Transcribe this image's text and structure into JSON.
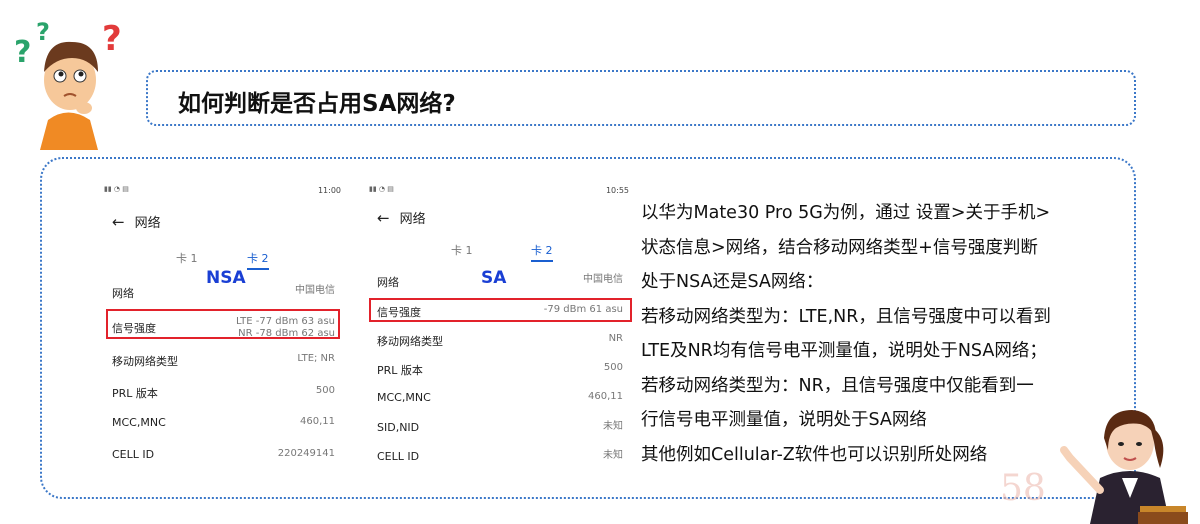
{
  "title": "如何判断是否占用SA网络?",
  "phone_nsa": {
    "time": "11:00",
    "page_title": "网络",
    "tabs": [
      "卡 1",
      "卡 2"
    ],
    "mode_label": "NSA",
    "rows": [
      {
        "label": "网络",
        "value": "中国电信"
      },
      {
        "label": "信号强度",
        "value_lines": [
          "LTE -77 dBm   63 asu",
          "NR -78 dBm   62 asu"
        ]
      },
      {
        "label": "移动网络类型",
        "value": "LTE; NR"
      },
      {
        "label": "PRL 版本",
        "value": "500"
      },
      {
        "label": "MCC,MNC",
        "value": "460,11"
      },
      {
        "label": "CELL ID",
        "value": "220249141"
      }
    ]
  },
  "phone_sa": {
    "time": "10:55",
    "page_title": "网络",
    "tabs": [
      "卡 1",
      "卡 2"
    ],
    "mode_label": "SA",
    "rows": [
      {
        "label": "网络",
        "value": "中国电信"
      },
      {
        "label": "信号强度",
        "value": "-79 dBm   61 asu"
      },
      {
        "label": "移动网络类型",
        "value": "NR"
      },
      {
        "label": "PRL 版本",
        "value": "500"
      },
      {
        "label": "MCC,MNC",
        "value": "460,11"
      },
      {
        "label": "SID,NID",
        "value": "未知"
      },
      {
        "label": "CELL ID",
        "value": "未知"
      }
    ]
  },
  "description": [
    "以华为Mate30 Pro 5G为例，通过 设置>关于手机>",
    "状态信息>网络，结合移动网络类型+信号强度判断",
    "处于NSA还是SA网络：",
    "若移动网络类型为：LTE,NR，且信号强度中可以看到",
    "LTE及NR均有信号电平测量值，说明处于NSA网络；",
    "若移动网络类型为：NR，且信号强度中仅能看到一",
    "行信号电平测量值，说明处于SA网络",
    "其他例如Cellular-Z软件也可以识别所处网络"
  ],
  "watermark": "58",
  "colors": {
    "accent_blue": "#3c78c8",
    "highlight_red": "#e2222b",
    "mode_label_blue": "#1a3fd4",
    "tab_active": "#1a5fd0"
  }
}
